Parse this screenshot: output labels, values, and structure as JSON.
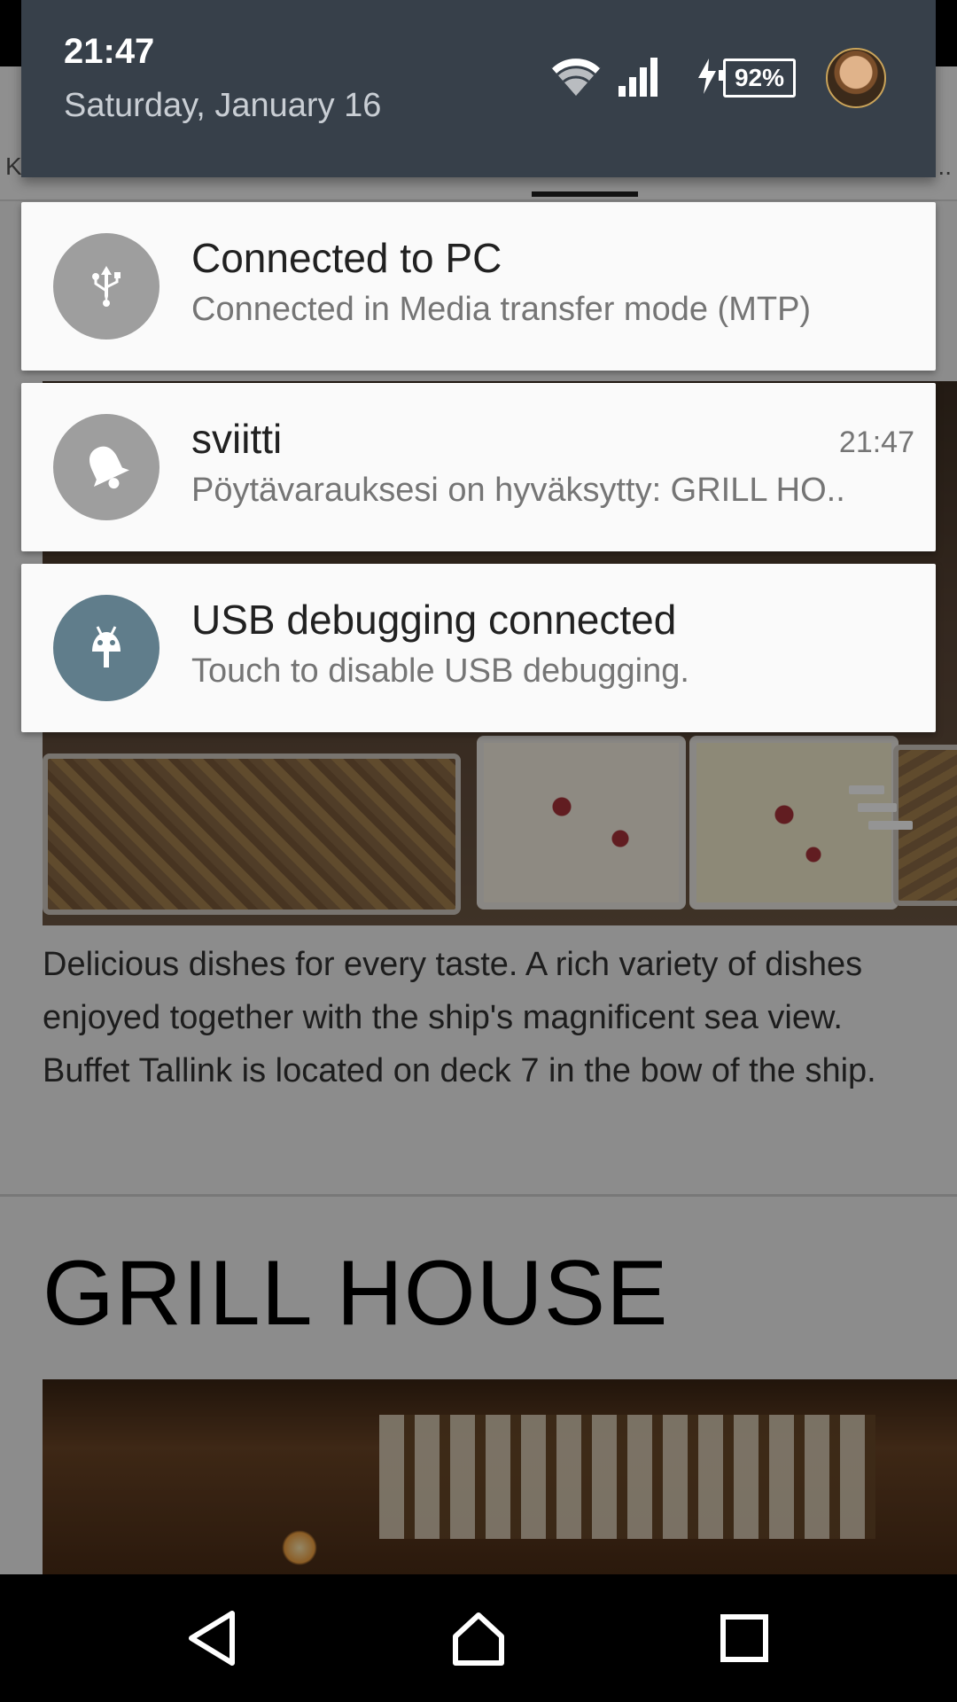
{
  "status": {
    "time": "21:47",
    "date": "Saturday, January 16",
    "battery_percent": "92%",
    "battery_level": 0.92,
    "charging": true,
    "wifi": "full",
    "signal": "strong"
  },
  "notifications": [
    {
      "icon": "usb-icon",
      "title": "Connected to PC",
      "text": "Connected in Media transfer mode (MTP)",
      "time": ""
    },
    {
      "icon": "bell-icon",
      "title": "sviitti",
      "text": "Pöytävarauksesi on hyväksytty: GRILL HO..",
      "time": "21:47"
    },
    {
      "icon": "android-debug-icon",
      "title": "USB debugging connected",
      "text": "Touch to disable USB debugging.",
      "time": ""
    }
  ],
  "app": {
    "tab_left_fragment": "K",
    "tab_right_fragment": "t...",
    "description": "Delicious dishes for every taste. A rich variety of dishes enjoyed together with the ship's magnificent sea view. Buffet Tallink is located on deck 7 in the bow of the ship.",
    "section_title": "GRILL HOUSE"
  },
  "navbar": {
    "back": "back-icon",
    "home": "home-icon",
    "recents": "recents-icon"
  },
  "colors": {
    "shade_header": "#37404a",
    "card_bg": "#fafafa",
    "icon_grey": "#9e9e9e",
    "icon_bluegrey": "#607d8b"
  }
}
